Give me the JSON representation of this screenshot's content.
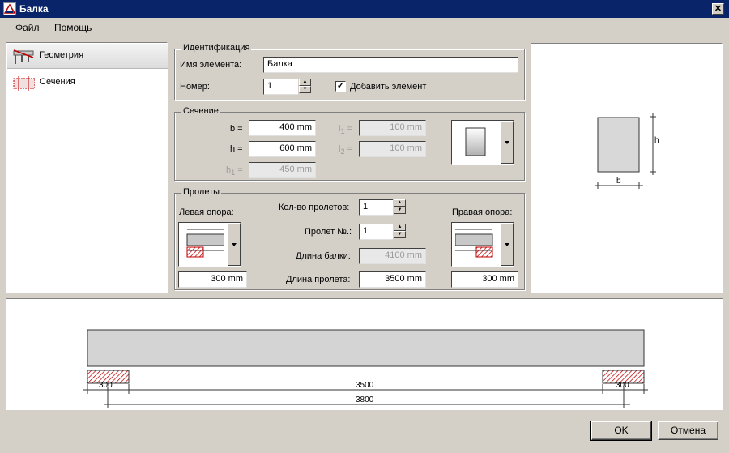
{
  "window": {
    "title": "Балка"
  },
  "menu": [
    "Файл",
    "Помощь"
  ],
  "nav": [
    {
      "label": "Геометрия",
      "icon": "beam-geometry-icon",
      "active": true
    },
    {
      "label": "Сечения",
      "icon": "beam-section-icon",
      "active": false
    }
  ],
  "identification": {
    "legend": "Идентификация",
    "name_label": "Имя элемента:",
    "name_value": "Балка",
    "number_label": "Номер:",
    "number_value": "1",
    "add_element_label": "Добавить элемент",
    "add_element_checked": true
  },
  "section": {
    "legend": "Сечение",
    "b": {
      "label": "b =",
      "value": "400",
      "unit": "mm"
    },
    "h": {
      "label": "h =",
      "value": "600",
      "unit": "mm"
    },
    "h1": {
      "label": "h",
      "sub": "1",
      "eq": " =",
      "value": "450",
      "unit": "mm"
    },
    "l1": {
      "label": "l",
      "sub": "1",
      "eq": " =",
      "value": "100",
      "unit": "mm"
    },
    "l2": {
      "label": "l",
      "sub": "2",
      "eq": " =",
      "value": "100",
      "unit": "mm"
    }
  },
  "spans": {
    "legend": "Пролеты",
    "left_support_label": "Левая опора:",
    "right_support_label": "Правая опора:",
    "span_count_label": "Кол-во пролетов:",
    "span_count_value": "1",
    "span_no_label": "Пролет №.:",
    "span_no_value": "1",
    "beam_length_label": "Длина балки:",
    "beam_length_value": "4100",
    "span_length_label": "Длина пролета:",
    "span_length_value": "3500",
    "left_support_width": "300",
    "right_support_width": "300",
    "unit": "mm"
  },
  "preview": {
    "b_label": "b",
    "h_label": "h"
  },
  "elevation": {
    "left_support_dim": "300",
    "right_support_dim": "300",
    "span_dim": "3500",
    "total_dim": "3800"
  },
  "buttons": {
    "ok": "OK",
    "cancel": "Отмена"
  },
  "colors": {
    "titlebar": "#0a246a",
    "face": "#d4d0c8",
    "hatch": "#c00000"
  }
}
